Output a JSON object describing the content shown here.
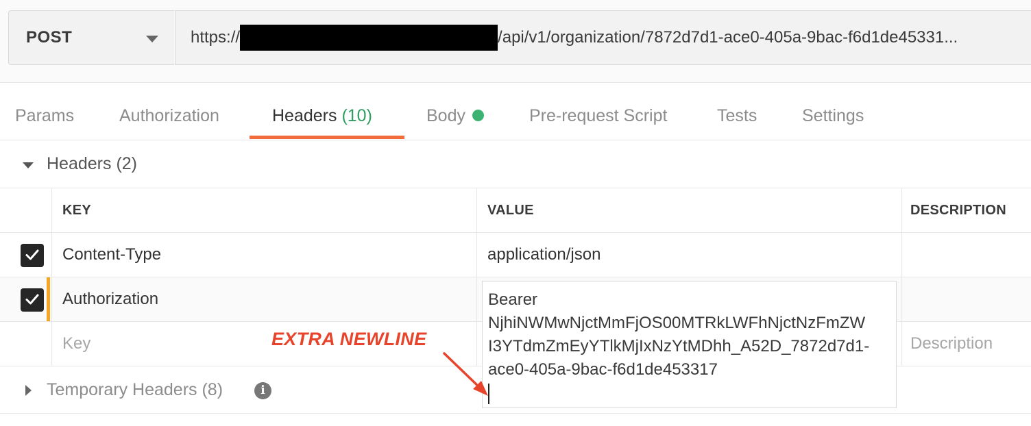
{
  "request": {
    "method": "POST",
    "url_prefix": "https://",
    "url_suffix": "/api/v1/organization/7872d7d1-ace0-405a-9bac-f6d1de45331..."
  },
  "tabs": [
    {
      "label": "Params"
    },
    {
      "label": "Authorization"
    },
    {
      "label": "Headers",
      "count": "(10)",
      "active": true
    },
    {
      "label": "Body",
      "indicator": "green-dot"
    },
    {
      "label": "Pre-request Script"
    },
    {
      "label": "Tests"
    },
    {
      "label": "Settings"
    }
  ],
  "headers_section": {
    "title": "Headers",
    "count": "(2)"
  },
  "table": {
    "columns": [
      "KEY",
      "VALUE",
      "DESCRIPTION"
    ],
    "rows": [
      {
        "checked": true,
        "key": "Content-Type",
        "value": "application/json",
        "description": ""
      },
      {
        "checked": true,
        "key": "Authorization",
        "value": "Bearer NjhiNWMwNjctMmFjOS00MTRkLWFhNjctNzFmZWI3YTdmZmEyYTlkMjIxNzYtMDhh_A52D_7872d7d1-ace0-405a-9bac-f6d1de453317",
        "description": ""
      }
    ],
    "new_row": {
      "key_placeholder": "Key",
      "description_placeholder": "Description"
    }
  },
  "value_editor": {
    "lines": [
      "Bearer",
      "NjhiNWMwNjctMmFjOS00MTRkLWFhNjctNzFmZW",
      "I3YTdmZmEyYTlkMjIxNzYtMDhh_A52D_7872d7d1-",
      "ace0-405a-9bac-f6d1de453317"
    ]
  },
  "temporary_headers": {
    "title": "Temporary Headers",
    "count": "(8)",
    "info_glyph": "i"
  },
  "annotation": {
    "label": "EXTRA NEWLINE",
    "color": "#e8432b"
  },
  "colors": {
    "active_tab_underline": "#f26b3a",
    "tab_count": "#2e9e60",
    "body_dot": "#3cb371",
    "edit_indicator": "#f5a623"
  }
}
